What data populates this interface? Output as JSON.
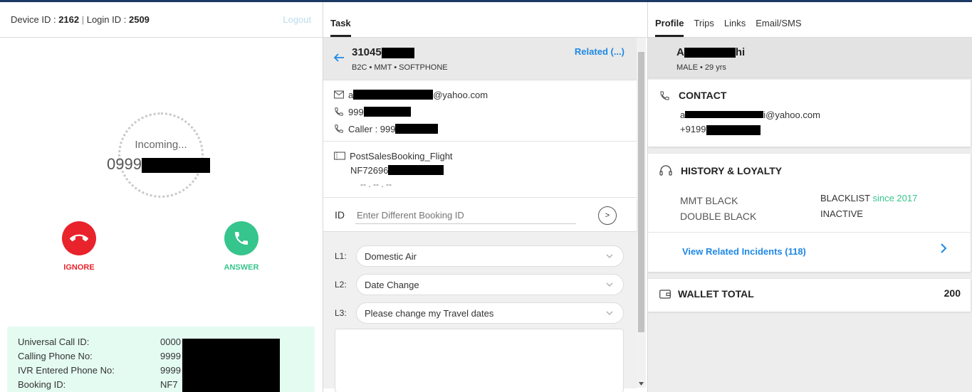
{
  "left": {
    "device_label": "Device ID : ",
    "device_id": "2162",
    "separator": " | ",
    "login_label": "Login ID : ",
    "login_id": "2509",
    "logout": "Logout",
    "incoming": "Incoming...",
    "incoming_number": "0999",
    "ignore": "IGNORE",
    "answer": "ANSWER",
    "info": [
      {
        "key": "Universal Call ID:",
        "value": "0000"
      },
      {
        "key": "Calling Phone No:",
        "value": "9999"
      },
      {
        "key": "IVR Entered Phone No:",
        "value": "9999"
      },
      {
        "key": "Booking ID:",
        "value": "NF7"
      }
    ]
  },
  "task": {
    "tab": "Task",
    "id": "31045",
    "sub": "B2C • MMT • SOFTPHONE",
    "related": "Related (...)",
    "email_prefix": "a",
    "email_suffix": "@yahoo.com",
    "phone": "999",
    "caller": "Caller : 999",
    "booking_type": "PostSalesBooking_Flight",
    "booking_ref": "NF72696",
    "booking_date": "-- . -- . --",
    "id_label": "ID",
    "id_placeholder": "Enter Different Booking ID",
    "go": ">",
    "l1_label": "L1:",
    "l1_value": "Domestic Air",
    "l2_label": "L2:",
    "l2_value": "Date Change",
    "l3_label": "L3:",
    "l3_value": "Please change my Travel dates"
  },
  "profile": {
    "tabs": [
      "Profile",
      "Trips",
      "Links",
      "Email/SMS"
    ],
    "name_start": "A",
    "name_end": "hi",
    "sub": "MALE • 29 yrs",
    "contact_title": "CONTACT",
    "contact_email_prefix": "a",
    "contact_email_suffix": "i@yahoo.com",
    "contact_phone": "+9199",
    "history_title": "HISTORY & LOYALTY",
    "tier1": "MMT BLACK",
    "status1": "BLACKLIST",
    "status1_since": " since 2017",
    "tier2": "DOUBLE BLACK",
    "status2": "INACTIVE",
    "related_incidents": "View Related Incidents (118)",
    "wallet_title": "WALLET TOTAL",
    "wallet_value": "200"
  },
  "colors": {
    "accent_blue": "#1e88e5",
    "ignore_red": "#e8232c",
    "answer_green": "#36c58c",
    "topline": "#1a3a64"
  }
}
